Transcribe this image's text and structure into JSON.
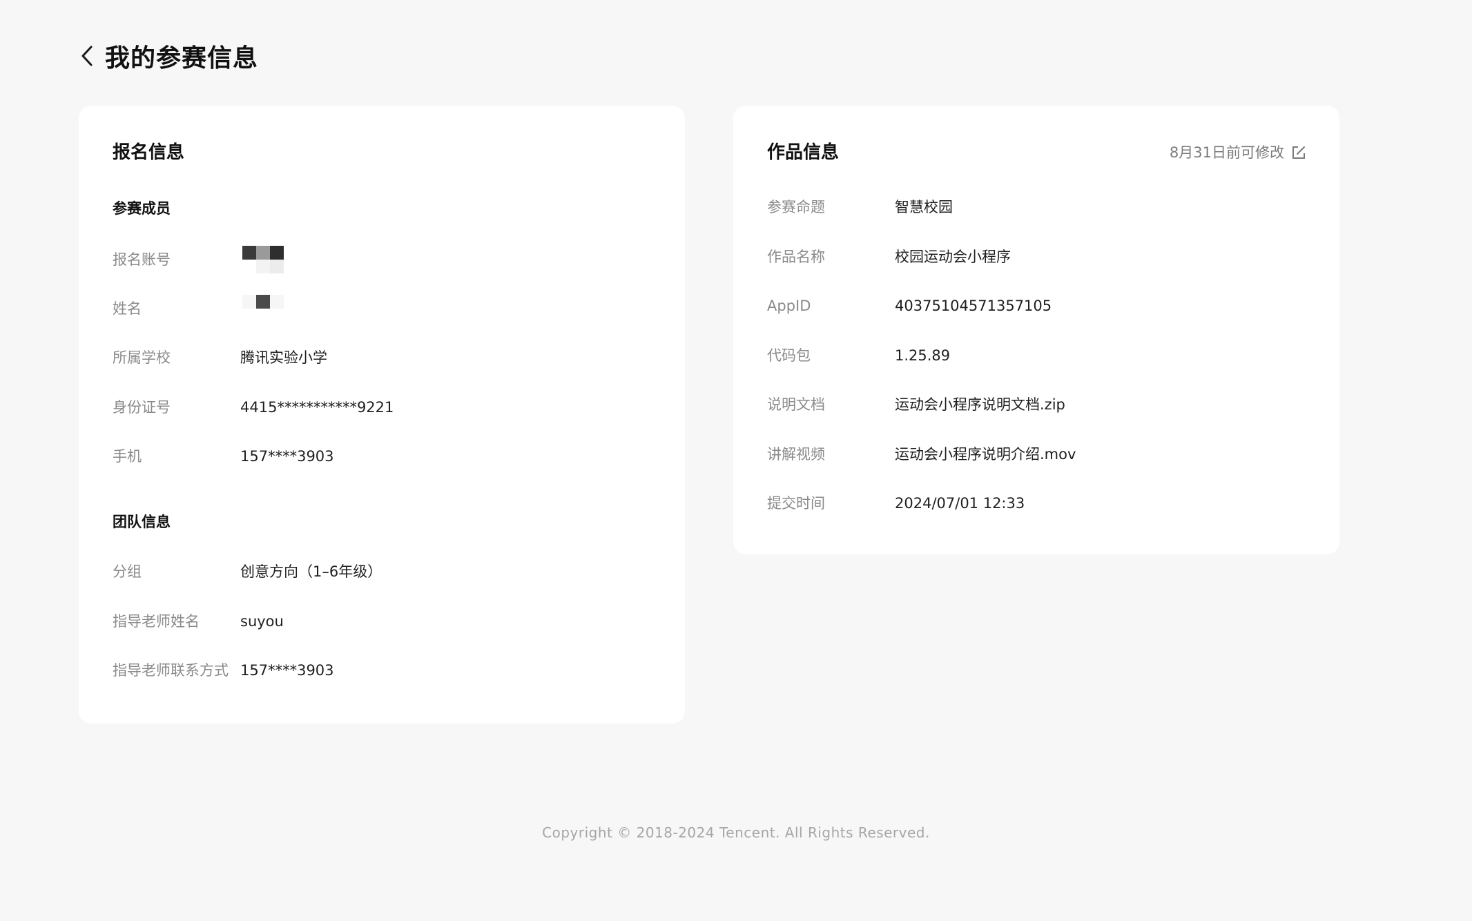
{
  "header": {
    "title": "我的参赛信息"
  },
  "registration": {
    "title": "报名信息",
    "members_section": "参赛成员",
    "members": [
      {
        "label": "报名账号",
        "value": ""
      },
      {
        "label": "姓名",
        "value": ""
      },
      {
        "label": "所属学校",
        "value": "腾讯实验小学"
      },
      {
        "label": "身份证号",
        "value": "4415***********9221"
      },
      {
        "label": "手机",
        "value": "157****3903"
      }
    ],
    "team_section": "团队信息",
    "team": [
      {
        "label": "分组",
        "value": "创意方向（1–6年级）"
      },
      {
        "label": "指导老师姓名",
        "value": "suyou"
      },
      {
        "label": "指导老师联系方式",
        "value": "157****3903"
      }
    ]
  },
  "work": {
    "title": "作品信息",
    "edit_label": "8月31日前可修改",
    "rows": [
      {
        "label": "参赛命题",
        "value": "智慧校园"
      },
      {
        "label": "作品名称",
        "value": "校园运动会小程序"
      },
      {
        "label": "AppID",
        "value": "40375104571357105"
      },
      {
        "label": "代码包",
        "value": "1.25.89"
      },
      {
        "label": "说明文档",
        "value": "运动会小程序说明文档.zip"
      },
      {
        "label": "讲解视频",
        "value": "运动会小程序说明介绍.mov"
      },
      {
        "label": "提交时间",
        "value": "2024/07/01 12:33"
      }
    ]
  },
  "footer": {
    "copyright": "Copyright © 2018-2024 Tencent. All Rights Reserved."
  },
  "icons": {
    "back": "chevron-left-icon",
    "edit": "edit-icon"
  },
  "colors": {
    "background": "#f7f7f7",
    "card": "#ffffff",
    "label": "#8a8a8a",
    "value": "#1f1f1f",
    "footer": "#a6a6a6"
  }
}
